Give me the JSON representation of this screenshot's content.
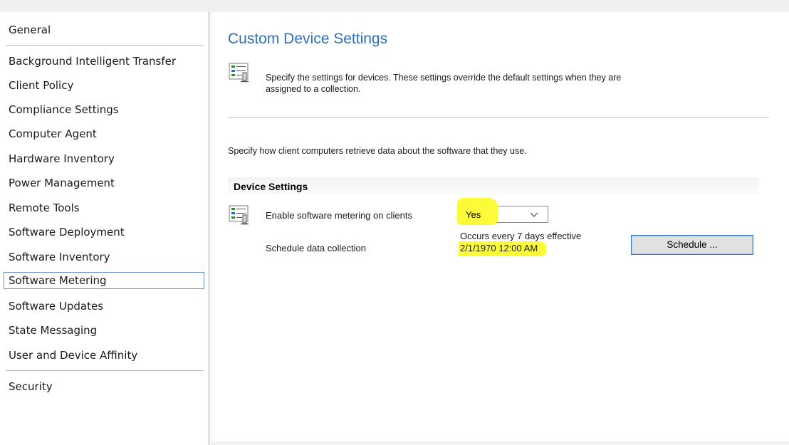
{
  "sidebar": {
    "items": [
      {
        "label": "General"
      },
      {
        "label": "Background Intelligent Transfer"
      },
      {
        "label": "Client Policy"
      },
      {
        "label": "Compliance Settings"
      },
      {
        "label": "Computer Agent"
      },
      {
        "label": "Hardware Inventory"
      },
      {
        "label": "Power Management"
      },
      {
        "label": "Remote Tools"
      },
      {
        "label": "Software Deployment"
      },
      {
        "label": "Software Inventory"
      },
      {
        "label": "Software Metering",
        "selected": true
      },
      {
        "label": "Software Updates"
      },
      {
        "label": "State Messaging"
      },
      {
        "label": "User and Device Affinity"
      },
      {
        "label": "Security"
      }
    ]
  },
  "main": {
    "title": "Custom Device Settings",
    "description_line1": "Specify the settings for devices. These settings override the default settings when they are",
    "description_line2": "assigned to a collection.",
    "intro": "Specify how client computers retrieve data about the software that they use.",
    "group_header": "Device Settings",
    "settings": {
      "enable_metering": {
        "label": "Enable software metering on clients",
        "value": "Yes"
      },
      "schedule": {
        "label": "Schedule data collection",
        "occurs_line1": "Occurs every 7 days effective",
        "occurs_line2": "2/1/1970 12:00 AM",
        "button_label": "Schedule ..."
      }
    }
  },
  "colors": {
    "title_blue": "#2e6fb5",
    "highlight_yellow": "#fbfb39",
    "selected_border": "#6e93c6",
    "button_border": "#2b78d0"
  },
  "icons": [
    "settings-list-icon",
    "chevron-down-icon"
  ]
}
